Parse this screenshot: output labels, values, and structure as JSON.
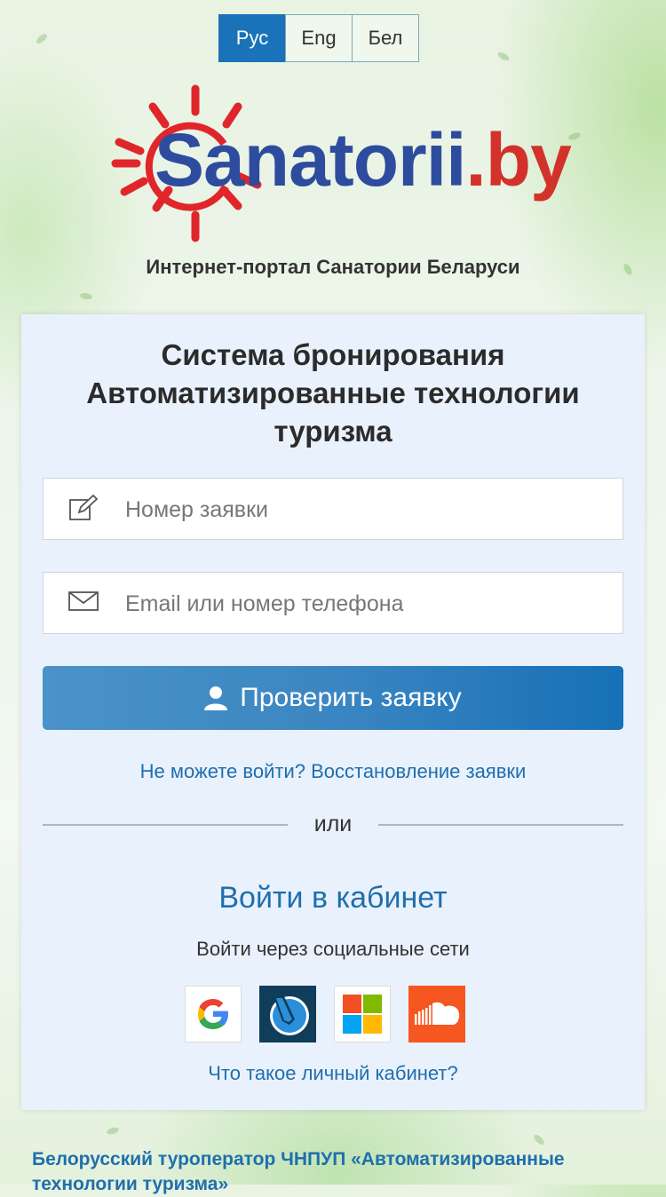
{
  "languages": [
    {
      "label": "Рус",
      "active": true
    },
    {
      "label": "Eng",
      "active": false
    },
    {
      "label": "Бел",
      "active": false
    }
  ],
  "logo": {
    "part1": "Sanatorii",
    "part2": ".by",
    "brand_blue": "#2e4c9e",
    "brand_red": "#d2322a"
  },
  "tagline": "Интернет-портал Санатории Беларуси",
  "card": {
    "title_lines": [
      "Система бронирования",
      "Автоматизированные технологии",
      "туризма"
    ],
    "order_field": {
      "placeholder": "Номер заявки",
      "icon": "edit-icon"
    },
    "contact_field": {
      "placeholder": "Email или номер телефона",
      "icon": "envelope-icon"
    },
    "check_button": {
      "label": "Проверить заявку",
      "icon": "user-icon",
      "color": "#1770b6"
    },
    "recover_link": "Не можете войти? Восстановление заявки",
    "or_text": "или",
    "cabinet_link": "Войти в кабинет",
    "social_label": "Войти через социальные сети",
    "social": [
      {
        "name": "google",
        "icon": "google-icon"
      },
      {
        "name": "livejournal",
        "icon": "livejournal-icon"
      },
      {
        "name": "microsoft",
        "icon": "microsoft-icon"
      },
      {
        "name": "soundcloud",
        "icon": "soundcloud-icon"
      }
    ],
    "what_cabinet_link": "Что такое личный кабинет?"
  },
  "footer": {
    "text": "Белорусский туроператор ЧНПУП «Автоматизированные технологии туризма»"
  }
}
